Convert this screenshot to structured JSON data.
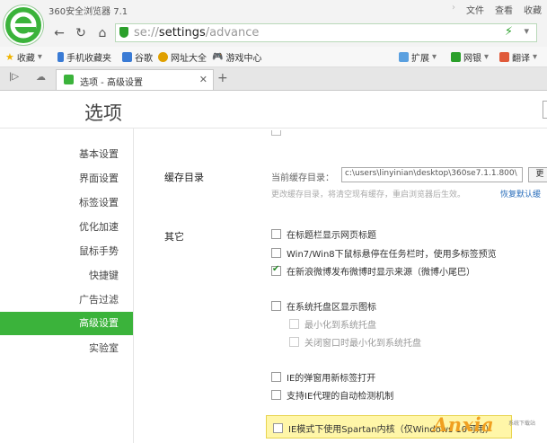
{
  "app": {
    "title": "360安全浏览器 7.1",
    "menu": [
      "文件",
      "查看",
      "收藏"
    ]
  },
  "address": {
    "scheme": "se://",
    "path_strong": "settings",
    "path_rest": "/advance"
  },
  "favorites": [
    {
      "label": "收藏",
      "icon": "star-icon",
      "color": "#f0b400"
    },
    {
      "label": "手机收藏夹",
      "icon": "phone-icon",
      "color": "#3a7bd5"
    },
    {
      "label": "谷歌",
      "icon": "google-icon",
      "color": "#3a7bd5"
    },
    {
      "label": "网址大全",
      "icon": "globe-icon",
      "color": "#e0a000"
    },
    {
      "label": "游戏中心",
      "icon": "gamepad-icon",
      "color": "#666666"
    }
  ],
  "toolbar_right": {
    "extensions": "扩展",
    "bank": "网银",
    "translate": "翻译"
  },
  "tab": {
    "label": "选项 - 高级设置"
  },
  "page": {
    "title": "选项"
  },
  "sidebar": {
    "items": [
      {
        "label": "基本设置",
        "active": false
      },
      {
        "label": "界面设置",
        "active": false
      },
      {
        "label": "标签设置",
        "active": false
      },
      {
        "label": "优化加速",
        "active": false
      },
      {
        "label": "鼠标手势",
        "active": false
      },
      {
        "label": "快捷键",
        "active": false
      },
      {
        "label": "广告过滤",
        "active": false
      },
      {
        "label": "高级设置",
        "active": true
      },
      {
        "label": "实验室",
        "active": false
      }
    ]
  },
  "cache": {
    "section_title": "缓存目录",
    "current_label": "当前缓存目录：",
    "path_value": "c:\\users\\linyinian\\desktop\\360se7.1.1.800\\",
    "button_label": "更",
    "note": "更改缓存目录，将清空现有缓存，重启浏览器后生效。",
    "restore_link": "恢复默认缓"
  },
  "other": {
    "section_title": "其它",
    "options": [
      {
        "label": "在标题栏显示网页标题",
        "checked": false,
        "disabled": false
      },
      {
        "label": "Win7/Win8下鼠标悬停在任务栏时，使用多标签预览",
        "checked": false,
        "disabled": false
      },
      {
        "label": "在新浪微博发布微博时显示来源（微博小尾巴）",
        "checked": true,
        "disabled": false
      },
      {
        "label": "在系统托盘区显示图标",
        "checked": false,
        "disabled": false
      },
      {
        "label": "最小化到系统托盘",
        "checked": false,
        "disabled": true
      },
      {
        "label": "关闭窗口时最小化到系统托盘",
        "checked": false,
        "disabled": true
      },
      {
        "label": "IE的弹窗用新标签打开",
        "checked": false,
        "disabled": false
      },
      {
        "label": "支持IE代理的自动检测机制",
        "checked": false,
        "disabled": false
      },
      {
        "label": "IE模式下使用Spartan内核（仅Windows 10可用）",
        "checked": false,
        "disabled": false
      }
    ]
  },
  "watermark": {
    "text": "Anxia",
    "sub": "系统下载站"
  }
}
